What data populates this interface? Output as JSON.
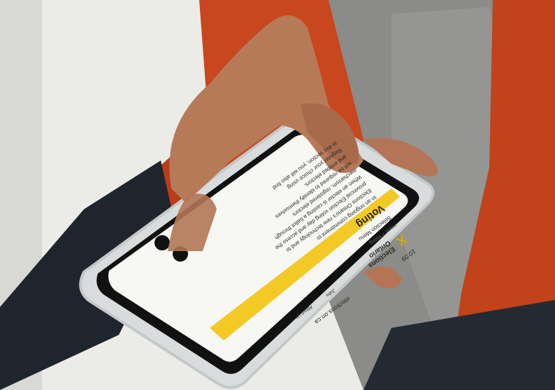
{
  "phone": {
    "status_time": "10:09",
    "url": "elections.on.ca",
    "brand_line1": "Elections",
    "brand_line2": "Ontario",
    "brand_mark": "X",
    "nav_items": [
      "About Us",
      "Jobs"
    ],
    "breadcrumb": "Home > Voting",
    "menu_label": "Selection Menu",
    "heading": "Voting",
    "body_lines": [
      "In an ongoing commitment to",
      "Elections Ontario's new technology and to",
      "provincial Election voting day and access the",
      "When an elector is casting a ballot through",
      "mechanism, registered electors",
      "will be required to identify themselves",
      "and entitled electors.",
      "Register your choice using",
      "In this section, you will also find"
    ]
  },
  "colors": {
    "jacket": "#c8471e",
    "shirt": "#8f8f8d",
    "skin": "#b77a59",
    "brand_yellow": "#f2c200",
    "screen": "#f7f7f4",
    "case": "#d9dcdd"
  }
}
